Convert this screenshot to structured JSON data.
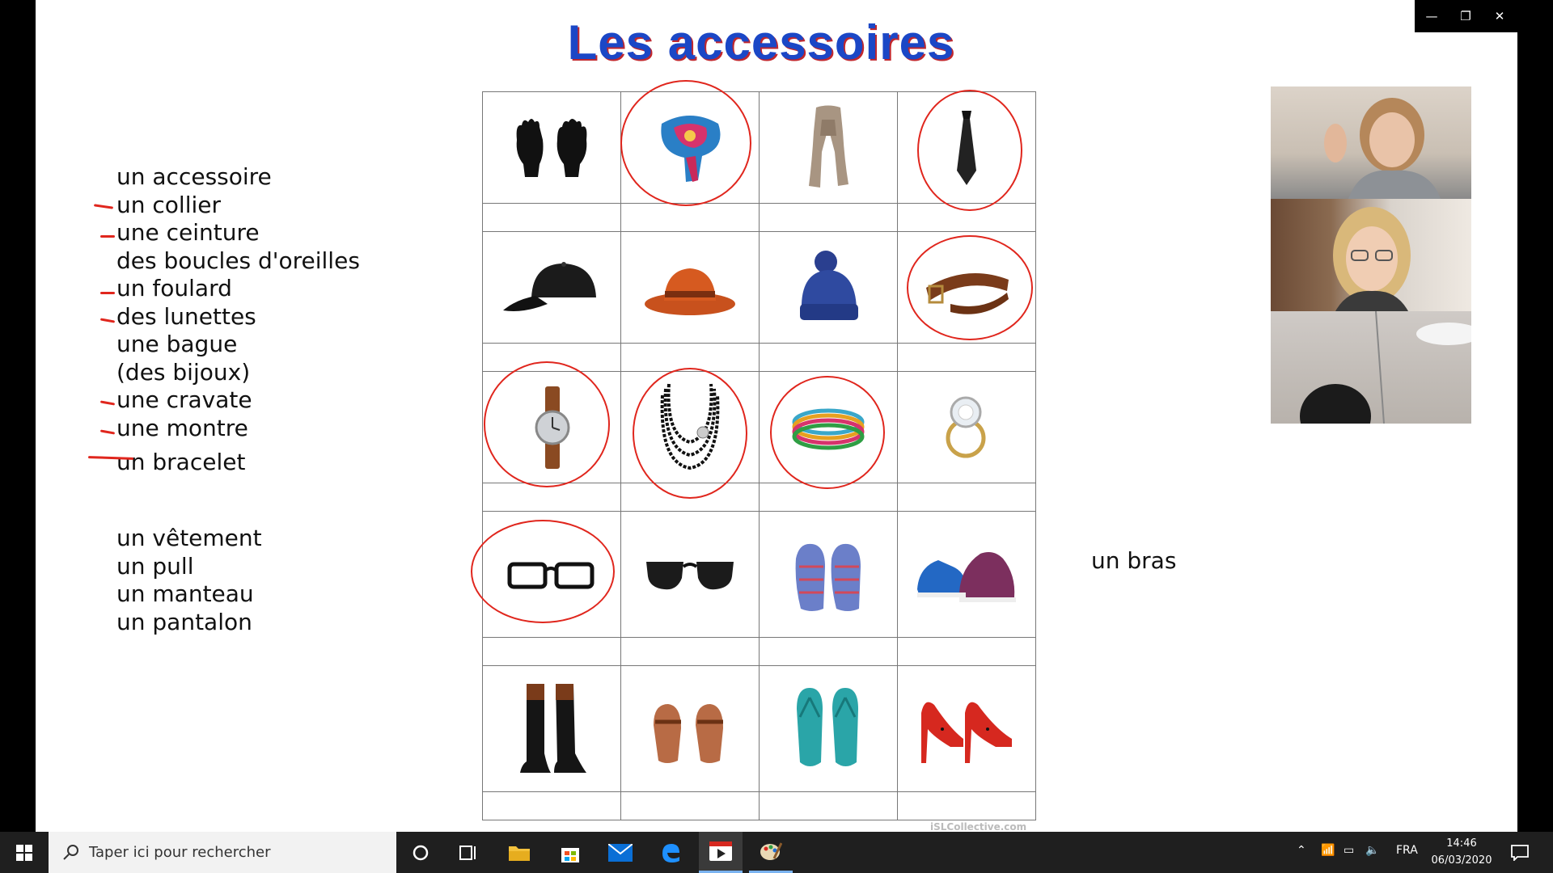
{
  "title": "Les accessoires",
  "window_controls": {
    "minimize": "—",
    "restore": "❐",
    "close": "✕"
  },
  "vocab_accessories": [
    "un accessoire",
    "un collier",
    "une ceinture",
    "des boucles d'oreilles",
    "un foulard",
    "des lunettes",
    "une bague",
    "(des bijoux)",
    "une cravate",
    "une montre",
    "un bracelet"
  ],
  "vocab_clothing": [
    "un vêtement",
    "un pull",
    "un manteau",
    "un pantalon"
  ],
  "side_word": "un bras",
  "watermark": "iSLCollective.com",
  "grid": {
    "rows": [
      [
        "gloves-icon",
        "scarf-silk-icon",
        "scarf-wool-icon",
        "tie-icon"
      ],
      [
        "cap-icon",
        "fedora-hat-icon",
        "beanie-icon",
        "belt-icon"
      ],
      [
        "watch-icon",
        "necklace-icon",
        "bracelets-icon",
        "ring-icon"
      ],
      [
        "glasses-icon",
        "sunglasses-icon",
        "slippers-icon",
        "sneakers-icon"
      ],
      [
        "boots-icon",
        "sandals-icon",
        "flip-flops-icon",
        "high-heels-icon"
      ]
    ],
    "circled": [
      "scarf-silk-icon",
      "tie-icon",
      "belt-icon",
      "watch-icon",
      "necklace-icon",
      "bracelets-icon",
      "glasses-icon"
    ]
  },
  "participants": [
    "participant-1-video",
    "participant-2-video",
    "participant-3-video"
  ],
  "taskbar": {
    "search_placeholder": "Taper ici pour rechercher",
    "language": "FRA",
    "time": "14:46",
    "date": "06/03/2020"
  },
  "colors": {
    "annotation_red": "#e0261d",
    "title_blue": "#1b47c6",
    "taskbar": "#1f1f1f"
  }
}
